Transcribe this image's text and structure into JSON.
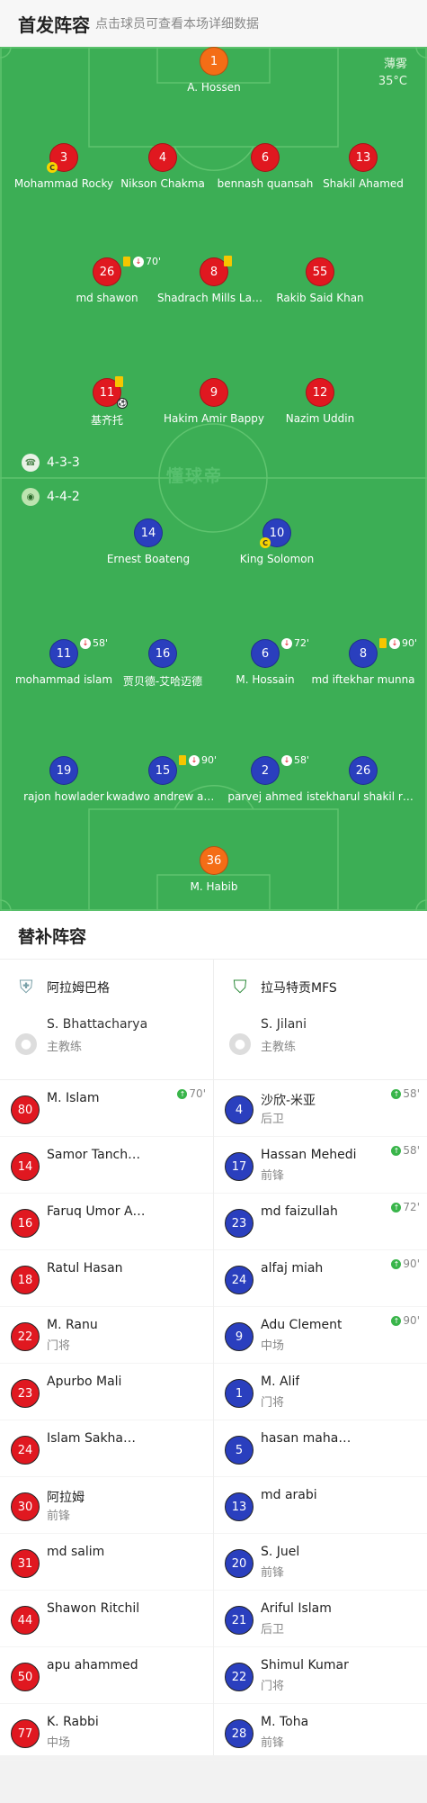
{
  "header": {
    "title": "首发阵容",
    "subtitle": "点击球员可查看本场详细数据"
  },
  "weather": {
    "condition": "薄雾",
    "temperature": "35°C"
  },
  "watermark": "懂球帝",
  "home": {
    "formation": "4-3-3",
    "goalkeeper": {
      "number": "1",
      "name": "A. Hossen"
    },
    "defenders": [
      {
        "number": "3",
        "name": "Mohammad Rocky",
        "captain": "C"
      },
      {
        "number": "4",
        "name": "Nikson Chakma"
      },
      {
        "number": "6",
        "name": "bennash quansah"
      },
      {
        "number": "13",
        "name": "Shakil Ahamed"
      }
    ],
    "midfielders": [
      {
        "number": "26",
        "name": "md shawon",
        "yellow_card": true,
        "sub_minute": "70'"
      },
      {
        "number": "8",
        "name": "Shadrach Mills Lamptey",
        "yellow_card": true
      },
      {
        "number": "55",
        "name": "Rakib Said Khan"
      }
    ],
    "forwards": [
      {
        "number": "11",
        "name": "基齐托",
        "yellow_card": true,
        "goal": true
      },
      {
        "number": "9",
        "name": "Hakim Amir Bappy"
      },
      {
        "number": "12",
        "name": "Nazim Uddin"
      }
    ]
  },
  "away": {
    "formation": "4-4-2",
    "forwards": [
      {
        "number": "14",
        "name": "Ernest Boateng"
      },
      {
        "number": "10",
        "name": "King Solomon",
        "captain": "C"
      }
    ],
    "midfielders": [
      {
        "number": "11",
        "name": "mohammad islam",
        "sub_minute": "58'"
      },
      {
        "number": "16",
        "name": "贾贝德-艾哈迈德"
      },
      {
        "number": "6",
        "name": "M. Hossain",
        "sub_minute": "72'"
      },
      {
        "number": "8",
        "name": "md iftekhar munna",
        "yellow_card": true,
        "sub_minute": "90'"
      }
    ],
    "defenders": [
      {
        "number": "19",
        "name": "rajon howlader"
      },
      {
        "number": "15",
        "name": "kwadwo andrew asante",
        "yellow_card": true,
        "sub_minute": "90'"
      },
      {
        "number": "2",
        "name": "parvej ahmed",
        "sub_minute": "58'"
      },
      {
        "number": "26",
        "name": "istekharul shakil rahman"
      }
    ],
    "goalkeeper": {
      "number": "36",
      "name": "M. Habib"
    }
  },
  "subs": {
    "title": "替补阵容",
    "home": {
      "team_name": "阿拉姆巴格",
      "coach": {
        "name": "S. Bhattacharya",
        "role": "主教练"
      },
      "players": [
        {
          "number": "80",
          "name": "M. Islam",
          "position": "",
          "in_minute": "70'"
        },
        {
          "number": "14",
          "name": "Samor Tanchangya",
          "position": ""
        },
        {
          "number": "16",
          "name": "Faruq Umor Alam",
          "position": ""
        },
        {
          "number": "18",
          "name": "Ratul Hasan",
          "position": ""
        },
        {
          "number": "22",
          "name": "M. Ranu",
          "position": "门将"
        },
        {
          "number": "23",
          "name": "Apurbo Mali",
          "position": ""
        },
        {
          "number": "24",
          "name": "Islam Sakhawat",
          "position": ""
        },
        {
          "number": "30",
          "name": "阿拉姆",
          "position": "前锋"
        },
        {
          "number": "31",
          "name": "md salim",
          "position": ""
        },
        {
          "number": "44",
          "name": "Shawon Ritchil",
          "position": ""
        },
        {
          "number": "50",
          "name": "apu ahammed",
          "position": ""
        },
        {
          "number": "77",
          "name": "K. Rabbi",
          "position": "中场"
        }
      ]
    },
    "away": {
      "team_name": "拉马特贡MFS",
      "coach": {
        "name": "S. Jilani",
        "role": "主教练"
      },
      "players": [
        {
          "number": "4",
          "name": "沙欣-米亚",
          "position": "后卫",
          "in_minute": "58'"
        },
        {
          "number": "17",
          "name": "Hassan Mehedi",
          "position": "前锋",
          "in_minute": "58'"
        },
        {
          "number": "23",
          "name": "md faizullah",
          "position": "",
          "in_minute": "72'"
        },
        {
          "number": "24",
          "name": "alfaj miah",
          "position": "",
          "in_minute": "90'"
        },
        {
          "number": "9",
          "name": "Adu Clement",
          "position": "中场",
          "in_minute": "90'"
        },
        {
          "number": "1",
          "name": "M. Alif",
          "position": "门将"
        },
        {
          "number": "5",
          "name": "hasan mahamud",
          "position": ""
        },
        {
          "number": "13",
          "name": "md arabi",
          "position": ""
        },
        {
          "number": "20",
          "name": "S. Juel",
          "position": "前锋"
        },
        {
          "number": "21",
          "name": "Ariful Islam",
          "position": "后卫"
        },
        {
          "number": "22",
          "name": "Shimul Kumar",
          "position": "门将"
        },
        {
          "number": "28",
          "name": "M. Toha",
          "position": "前锋"
        }
      ]
    }
  }
}
